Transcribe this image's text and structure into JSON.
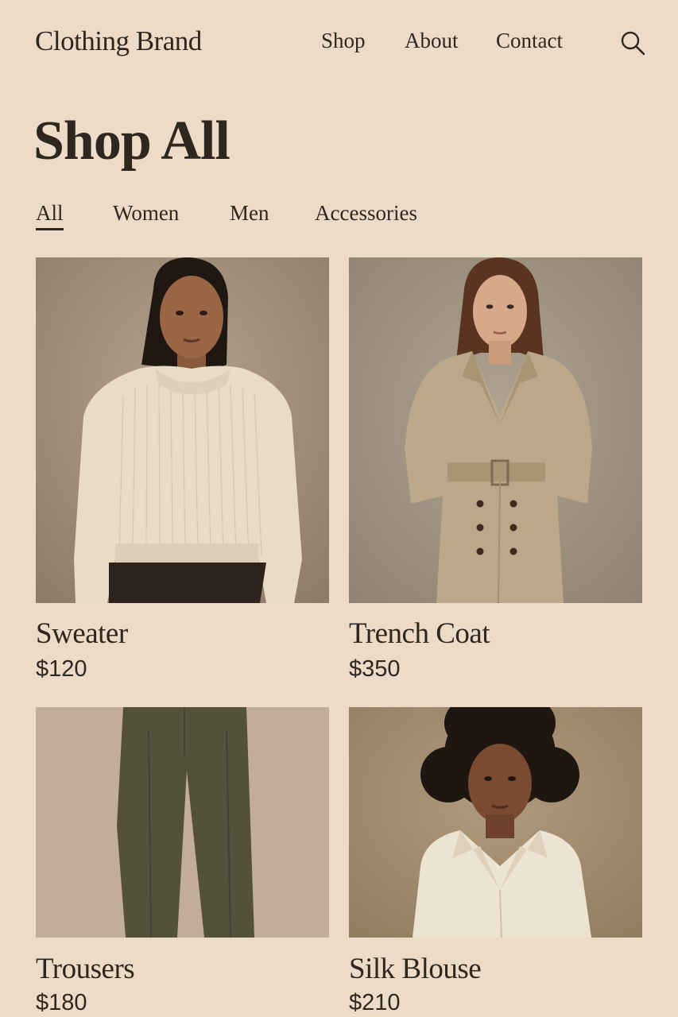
{
  "header": {
    "brand": "Clothing Brand",
    "nav": [
      {
        "label": "Shop"
      },
      {
        "label": "About"
      },
      {
        "label": "Contact"
      }
    ],
    "search_icon": "search-icon"
  },
  "page": {
    "title": "Shop All"
  },
  "filters": {
    "active": "All",
    "items": [
      {
        "label": "All"
      },
      {
        "label": "Women"
      },
      {
        "label": "Men"
      },
      {
        "label": "Accessories"
      }
    ]
  },
  "products": [
    {
      "name": "Sweater",
      "price": "$120"
    },
    {
      "name": "Trench Coat",
      "price": "$350"
    },
    {
      "name": "Trousers",
      "price": "$180"
    },
    {
      "name": "Silk Blouse",
      "price": "$210"
    }
  ],
  "colors": {
    "background": "#ecdcc7",
    "text": "#2e2720"
  }
}
